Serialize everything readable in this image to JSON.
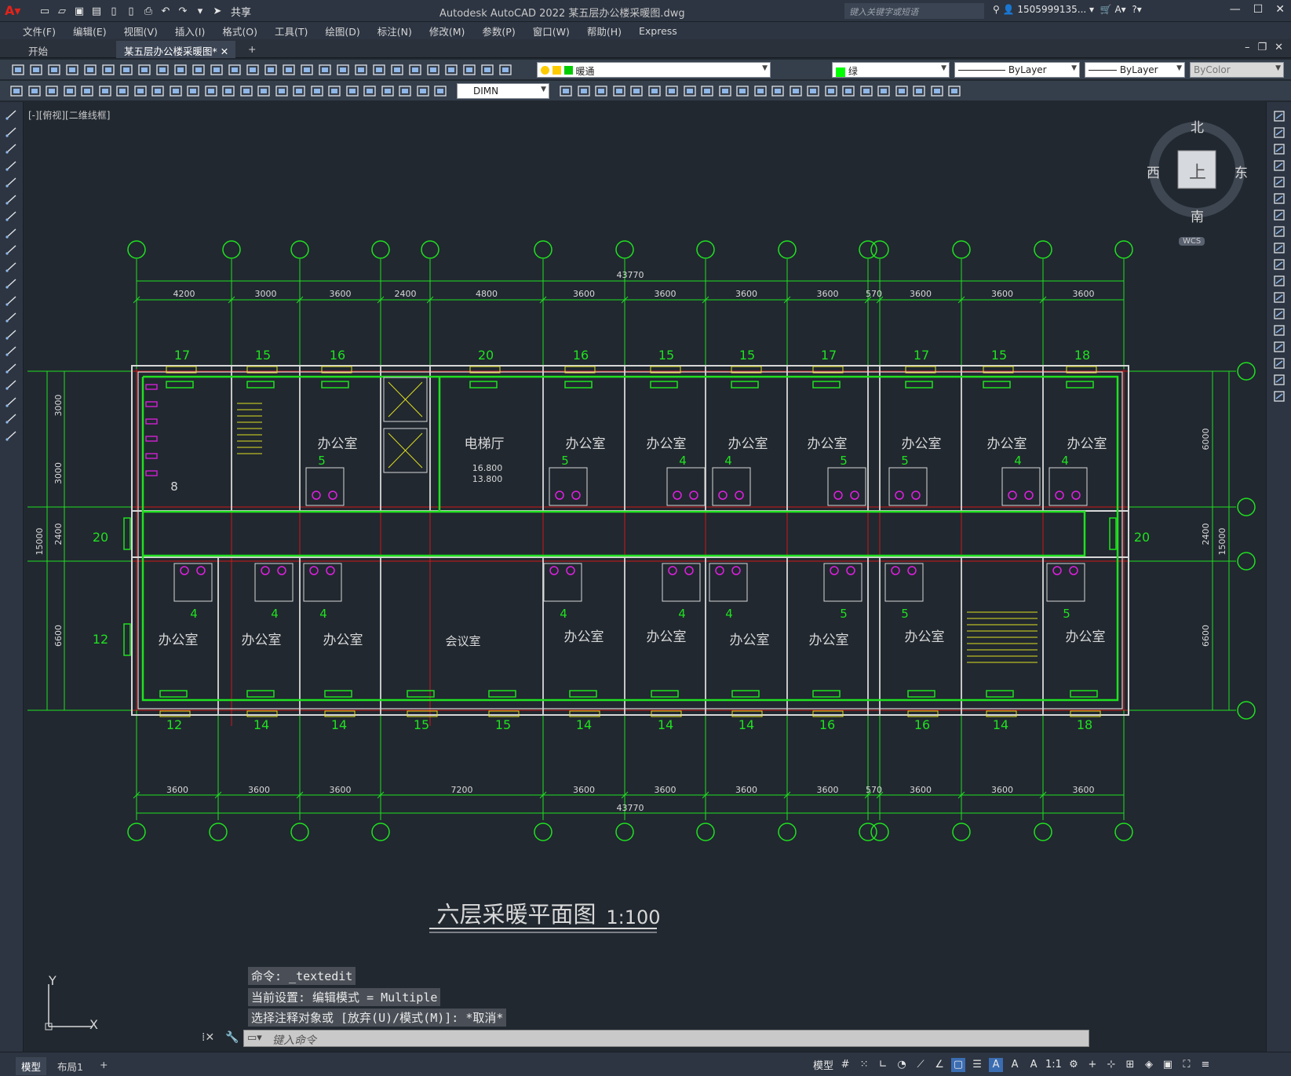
{
  "titlebar": {
    "app_title": "Autodesk AutoCAD 2022    某五层办公楼采暖图.dwg",
    "search_placeholder": "键入关键字或短语",
    "user": "1505999135...",
    "share": "共享"
  },
  "menu": [
    "文件(F)",
    "编辑(E)",
    "视图(V)",
    "插入(I)",
    "格式(O)",
    "工具(T)",
    "绘图(D)",
    "标注(N)",
    "修改(M)",
    "参数(P)",
    "窗口(W)",
    "帮助(H)",
    "Express"
  ],
  "tabs": {
    "start": "开始",
    "doc": "某五层办公楼采暖图*"
  },
  "toolbar": {
    "layer": "暖通",
    "color": "绿",
    "linetype": "ByLayer",
    "lineweight": "ByLayer",
    "plotstyle": "ByColor",
    "dimstyle": "DIMN"
  },
  "viewport_label": "[-][俯视][二维线框]",
  "viewcube": {
    "north": "北",
    "south": "南",
    "east": "东",
    "west": "西",
    "top": "上",
    "wcs": "WCS"
  },
  "drawing": {
    "overall_dim": "43770",
    "top_dims": [
      "4200",
      "3000",
      "3600",
      "2400",
      "4800",
      "3600",
      "3600",
      "3600",
      "3600",
      "570",
      "3600",
      "3600",
      "3600"
    ],
    "bottom_dims": [
      "3600",
      "3600",
      "3600",
      "7200",
      "3600",
      "3600",
      "3600",
      "3600",
      "570",
      "3600",
      "3600",
      "3600"
    ],
    "left_dims": [
      "3000",
      "3000",
      "2400",
      "6600"
    ],
    "left_total": "15000",
    "right_dims": [
      "6000",
      "2400",
      "6600"
    ],
    "right_total": "15000",
    "top_radiators": [
      "17",
      "15",
      "16",
      "20",
      "16",
      "15",
      "15",
      "17",
      "17",
      "15",
      "18"
    ],
    "bottom_radiators": [
      "12",
      "14",
      "14",
      "15",
      "15",
      "14",
      "14",
      "14",
      "16",
      "16",
      "14",
      "18"
    ],
    "side_radiators": {
      "left_mid": "20",
      "right_mid": "20",
      "left_low": "12",
      "toilet": "8"
    },
    "upper_rooms": [
      "办公室",
      "电梯厅",
      "办公室",
      "办公室",
      "办公室",
      "办公室",
      "办公室",
      "办公室",
      "办公室"
    ],
    "upper_toilet_nums": [
      "5",
      "5",
      "4",
      "4",
      "5",
      "5",
      "4",
      "4"
    ],
    "lower_rooms": [
      "办公室",
      "办公室",
      "办公室",
      "会议室",
      "办公室",
      "办公室",
      "办公室",
      "办公室",
      "办公室",
      "办公室"
    ],
    "lower_toilet_nums": [
      "4",
      "4",
      "4",
      "4",
      "4",
      "4",
      "5",
      "5",
      "5"
    ],
    "elev1": "16.800",
    "elev2": "13.800",
    "title": "六层采暖平面图",
    "scale": "1:100"
  },
  "command": {
    "line1": "命令: _textedit",
    "line2": "当前设置: 编辑模式 = Multiple",
    "line3": "选择注释对象或 [放弃(U)/模式(M)]: *取消*",
    "placeholder": "键入命令"
  },
  "ucs": {
    "x": "X",
    "y": "Y"
  },
  "status": {
    "model_tab": "模型",
    "layout_tab": "布局1",
    "model_label": "模型",
    "scale": "1:1"
  }
}
